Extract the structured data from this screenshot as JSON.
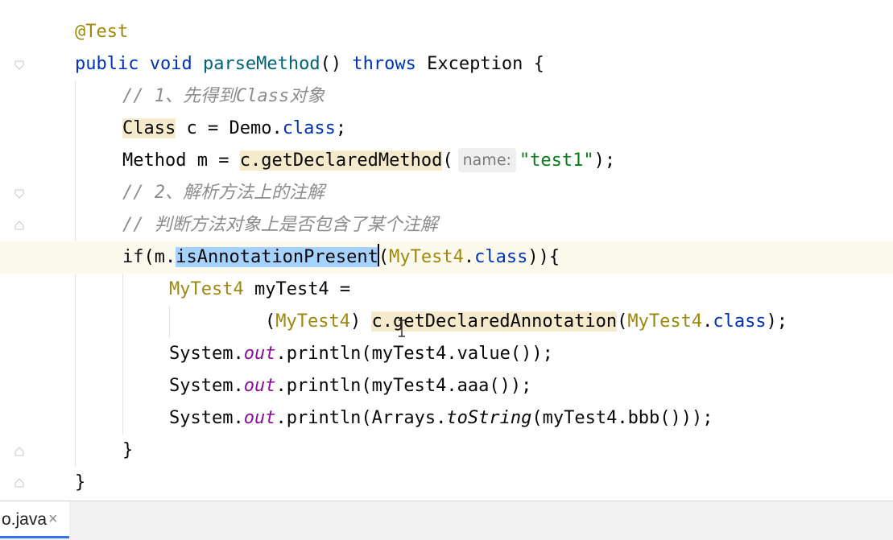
{
  "editor": {
    "lines": [
      {
        "tokens": [
          {
            "t": "@Test",
            "c": "ann"
          }
        ]
      },
      {
        "tokens": [
          {
            "t": "public ",
            "c": "kw"
          },
          {
            "t": "void ",
            "c": "kw"
          },
          {
            "t": "parseMethod",
            "c": "fn"
          },
          {
            "t": "() ",
            "c": ""
          },
          {
            "t": "throws ",
            "c": "kw"
          },
          {
            "t": "Exception {",
            "c": ""
          }
        ]
      },
      {
        "tokens": [
          {
            "t": "// 1、先得到Class对象",
            "c": "cm"
          }
        ]
      },
      {
        "tokens": [
          {
            "t": "Class",
            "c": "hl"
          },
          {
            "t": " c = Demo.",
            "c": ""
          },
          {
            "t": "class",
            "c": "kw"
          },
          {
            "t": ";",
            "c": ""
          }
        ]
      },
      {
        "tokens": [
          {
            "t": "Method m = ",
            "c": ""
          },
          {
            "t": "c.getDeclaredMethod",
            "c": "hl"
          },
          {
            "t": "(",
            "c": ""
          },
          {
            "t": "name:",
            "c": "hint"
          },
          {
            "t": "\"test1\"",
            "c": "str"
          },
          {
            "t": ");",
            "c": ""
          }
        ]
      },
      {
        "tokens": [
          {
            "t": "// 2、解析方法上的注解",
            "c": "cm"
          }
        ]
      },
      {
        "tokens": [
          {
            "t": "// 判断方法对象上是否包含了某个注解",
            "c": "cm"
          }
        ]
      },
      {
        "tokens": [
          {
            "t": "if(m.",
            "c": ""
          },
          {
            "t": "isAnnotationPresent",
            "c": "sel"
          },
          {
            "t": "",
            "c": "caret"
          },
          {
            "t": "(",
            "c": ""
          },
          {
            "t": "MyTest4",
            "c": "ty"
          },
          {
            "t": ".",
            "c": ""
          },
          {
            "t": "class",
            "c": "kw"
          },
          {
            "t": ")){",
            "c": ""
          }
        ]
      },
      {
        "tokens": [
          {
            "t": "MyTest4",
            "c": "ty"
          },
          {
            "t": " myTest4 =",
            "c": ""
          }
        ]
      },
      {
        "tokens": [
          {
            "t": "(",
            "c": ""
          },
          {
            "t": "MyTest4",
            "c": "ty"
          },
          {
            "t": ") ",
            "c": ""
          },
          {
            "t": "c.getDeclaredAnnotation",
            "c": "hl"
          },
          {
            "t": "(",
            "c": ""
          },
          {
            "t": "MyTest4",
            "c": "ty"
          },
          {
            "t": ".",
            "c": ""
          },
          {
            "t": "class",
            "c": "kw"
          },
          {
            "t": ");",
            "c": ""
          }
        ]
      },
      {
        "tokens": [
          {
            "t": "System.",
            "c": ""
          },
          {
            "t": "out",
            "c": "fld"
          },
          {
            "t": ".println(myTest4.value());",
            "c": ""
          }
        ]
      },
      {
        "tokens": [
          {
            "t": "System.",
            "c": ""
          },
          {
            "t": "out",
            "c": "fld"
          },
          {
            "t": ".println(myTest4.aaa());",
            "c": ""
          }
        ]
      },
      {
        "tokens": [
          {
            "t": "System.",
            "c": ""
          },
          {
            "t": "out",
            "c": "fld"
          },
          {
            "t": ".println(Arrays.",
            "c": ""
          },
          {
            "t": "toString",
            "c": "it"
          },
          {
            "t": "(myTest4.bbb()));",
            "c": ""
          }
        ]
      },
      {
        "tokens": [
          {
            "t": "}",
            "c": ""
          }
        ]
      },
      {
        "tokens": [
          {
            "t": "}",
            "c": ""
          }
        ]
      }
    ]
  },
  "tabs": [
    {
      "label": "o.java",
      "close": "×",
      "active": true
    }
  ],
  "icons": [
    "fold-icon",
    "lightbulb-icon",
    "close-icon",
    "text-cursor-icon"
  ],
  "colors": {
    "keyword": "#0033b3",
    "annotation": "#9e880d",
    "comment": "#8c8c8c",
    "string": "#067d17",
    "selection": "#a6d2ff",
    "usage_highlight": "#f5eacc"
  }
}
